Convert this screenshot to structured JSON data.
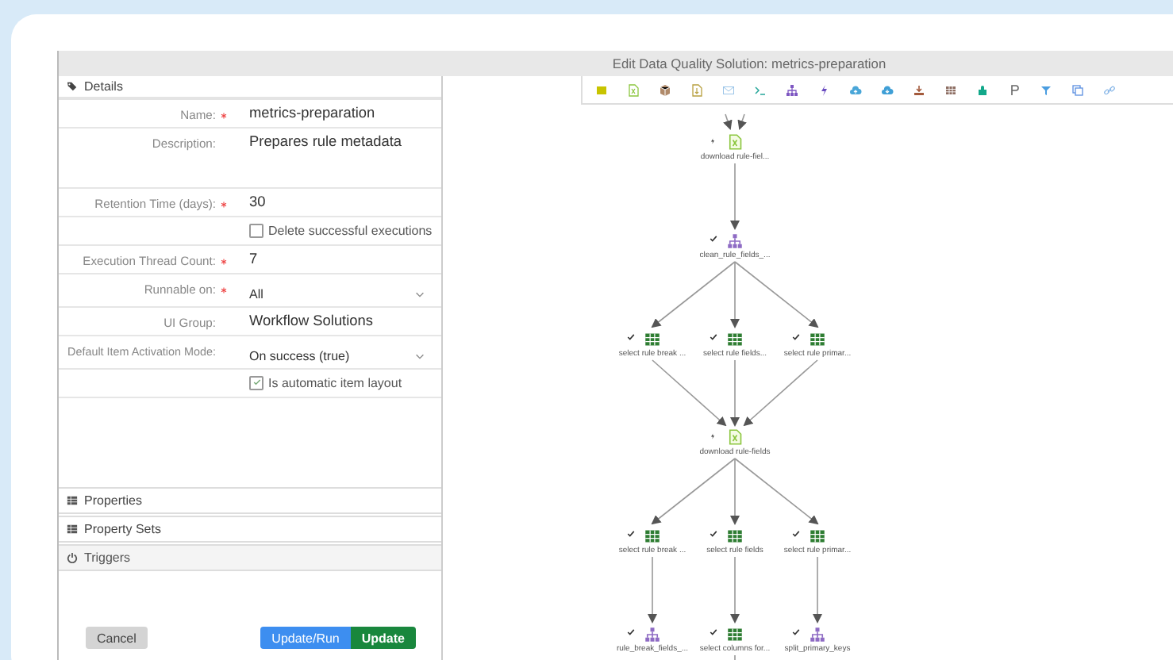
{
  "window": {
    "title": "Edit Data Quality Solution: metrics-preparation"
  },
  "details": {
    "title": "Details",
    "fields": [
      {
        "kind": "text",
        "label": "Name:",
        "required": true,
        "value": "metrics-preparation"
      },
      {
        "kind": "textarea",
        "label": "Description:",
        "required": false,
        "value": "Prepares rule metadata"
      },
      {
        "kind": "text",
        "label": "Retention Time (days):",
        "required": true,
        "value": "30"
      },
      {
        "kind": "checkbox",
        "label": "Delete successful executions",
        "checked": false
      },
      {
        "kind": "text",
        "label": "Execution Thread Count:",
        "required": true,
        "value": "7"
      },
      {
        "kind": "select",
        "label": "Runnable on:",
        "required": true,
        "value": "All"
      },
      {
        "kind": "text",
        "label": "UI Group:",
        "required": false,
        "value": "Workflow Solutions"
      },
      {
        "kind": "select",
        "label": "Default Item Activation Mode:",
        "required": false,
        "value": "On success (true)"
      },
      {
        "kind": "checkbox",
        "label": "Is automatic item layout",
        "checked": true
      }
    ]
  },
  "sections": [
    {
      "kind": "table",
      "label": "Properties",
      "selected": false
    },
    {
      "kind": "table",
      "label": "Property Sets",
      "selected": false
    },
    {
      "kind": "trigger",
      "label": "Triggers",
      "selected": true
    }
  ],
  "buttons": [
    {
      "kind": "secondary",
      "label": "Cancel"
    },
    {
      "kind": "info",
      "label": "Update/Run"
    },
    {
      "kind": "primary",
      "label": "Update"
    }
  ],
  "diagram": {
    "levels": [
      [
        {
          "kind": "file",
          "done": false,
          "label": "download rule-fiel..."
        }
      ],
      [
        {
          "kind": "tree",
          "done": true,
          "label": "clean_rule_fields_..."
        }
      ],
      [
        {
          "kind": "grid",
          "done": true,
          "label": "select rule break ..."
        },
        {
          "kind": "grid",
          "done": true,
          "label": "select rule fields..."
        },
        {
          "kind": "grid",
          "done": true,
          "label": "select rule primar..."
        }
      ],
      [
        {
          "kind": "file",
          "done": false,
          "label": "download rule-fields"
        }
      ],
      [
        {
          "kind": "grid",
          "done": true,
          "label": "select rule break ..."
        },
        {
          "kind": "grid",
          "done": true,
          "label": "select rule fields"
        },
        {
          "kind": "grid",
          "done": true,
          "label": "select rule primar..."
        }
      ],
      [
        {
          "kind": "tree",
          "done": true,
          "label": "rule_break_fields_..."
        },
        {
          "kind": "grid",
          "done": true,
          "label": "select columns for..."
        },
        {
          "kind": "tree",
          "done": true,
          "label": "split_primary_keys"
        }
      ]
    ]
  }
}
